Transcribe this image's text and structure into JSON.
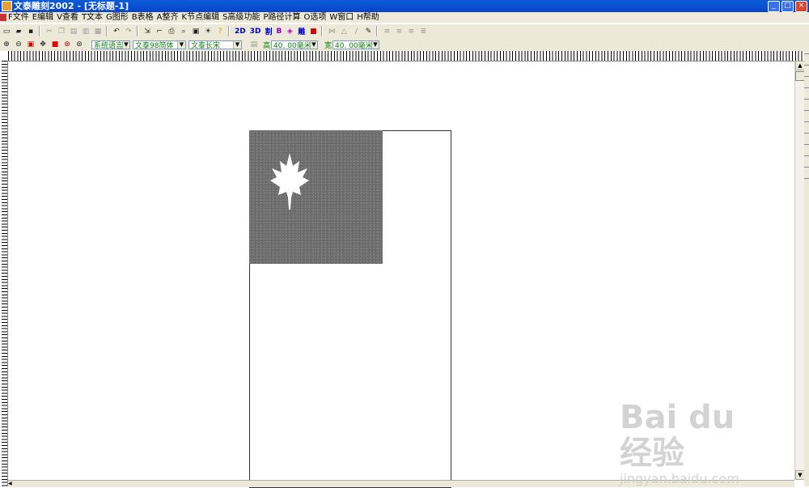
{
  "window": {
    "title": "文泰雕刻2002 - [无标题-1]"
  },
  "menu": [
    "F文件",
    "E编辑",
    "V查看",
    "T文本",
    "G图形",
    "B表格",
    "A整齐",
    "K节点编辑",
    "S高级功能",
    "P路径计算",
    "O选项",
    "W窗口",
    "H帮助"
  ],
  "toolbar1": {
    "labels": [
      "2D",
      "3D",
      "割",
      "B",
      "刻",
      "雕"
    ]
  },
  "toolbar2": {
    "language": "系统语言",
    "font_cn": "文泰98简体",
    "font_en": "文泰长宋",
    "height_label": "高",
    "height_value": "40. 00毫米",
    "width_label": "宽",
    "width_value": "40. 00毫米"
  },
  "watermark": {
    "line1": "Bai du 经验",
    "line2": "jingyan.baidu.com"
  },
  "colors": {
    "titlebar": "#0845c8",
    "chrome": "#ece9d8",
    "graphic": "#6b6b6b",
    "stop_icon": "#e00000"
  },
  "graphic": {
    "icon": "maple-leaf-icon"
  }
}
